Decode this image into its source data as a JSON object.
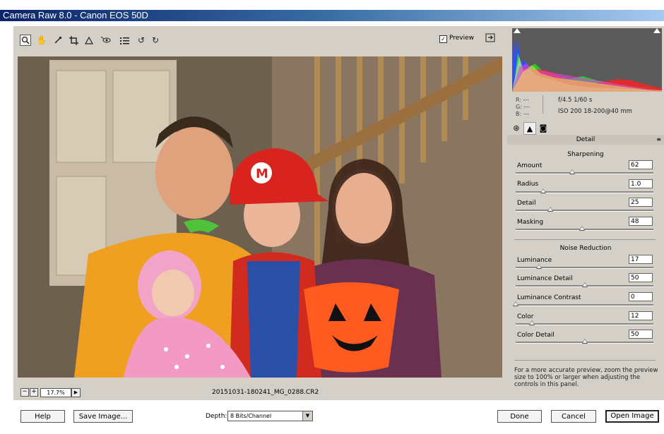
{
  "window": {
    "title": "Camera Raw 8.0  -  Canon EOS 50D"
  },
  "toolbar": {
    "tools": [
      {
        "name": "zoom-tool",
        "icon": "magnifier-icon",
        "glyph": "🔍",
        "active": true
      },
      {
        "name": "hand-tool",
        "icon": "hand-icon",
        "glyph": "✋"
      },
      {
        "name": "white-balance-tool",
        "icon": "eyedropper-icon",
        "glyph": "✎"
      },
      {
        "name": "crop-tool",
        "icon": "crop-icon",
        "glyph": "⌗"
      },
      {
        "name": "straighten-tool",
        "icon": "straighten-icon",
        "glyph": "⊿"
      },
      {
        "name": "red-eye-tool",
        "icon": "red-eye-icon",
        "glyph": "◉"
      },
      {
        "name": "preferences-tool",
        "icon": "list-icon",
        "glyph": "☰"
      },
      {
        "name": "rotate-left-tool",
        "icon": "rotate-ccw-icon",
        "glyph": "↺"
      },
      {
        "name": "rotate-right-tool",
        "icon": "rotate-cw-icon",
        "glyph": "↻"
      }
    ],
    "preview_label": "Preview",
    "preview_checked": true
  },
  "status": {
    "zoom_level": "17.7%",
    "filename": "20151031-180241_MG_0288.CR2"
  },
  "info": {
    "r": "R:  ---",
    "g": "G:  ---",
    "b": "B:  ---",
    "aperture_shutter": "f/4.5   1/60 s",
    "iso_lens": "ISO 200   18-200@40 mm"
  },
  "panel": {
    "title": "Detail",
    "sharpening": {
      "title": "Sharpening",
      "sliders": [
        {
          "label": "Amount",
          "value": "62",
          "fraction": 0.41
        },
        {
          "label": "Radius",
          "value": "1.0",
          "fraction": 0.2
        },
        {
          "label": "Detail",
          "value": "25",
          "fraction": 0.25
        },
        {
          "label": "Masking",
          "value": "48",
          "fraction": 0.48
        }
      ]
    },
    "noise_reduction": {
      "title": "Noise Reduction",
      "sliders": [
        {
          "label": "Luminance",
          "value": "17",
          "fraction": 0.17
        },
        {
          "label": "Luminance Detail",
          "value": "50",
          "fraction": 0.5
        },
        {
          "label": "Luminance Contrast",
          "value": "0",
          "fraction": 0.0
        },
        {
          "label": "Color",
          "value": "12",
          "fraction": 0.12
        },
        {
          "label": "Color Detail",
          "value": "50",
          "fraction": 0.5
        }
      ]
    },
    "note": "For a more accurate preview, zoom the preview size to 100% or larger when adjusting the controls in this panel."
  },
  "bottom": {
    "help_label": "Help",
    "save_label": "Save Image...",
    "depth_label": "Depth:",
    "depth_value": "8 Bits/Channel",
    "done_label": "Done",
    "cancel_label": "Cancel",
    "open_label": "Open Image"
  }
}
